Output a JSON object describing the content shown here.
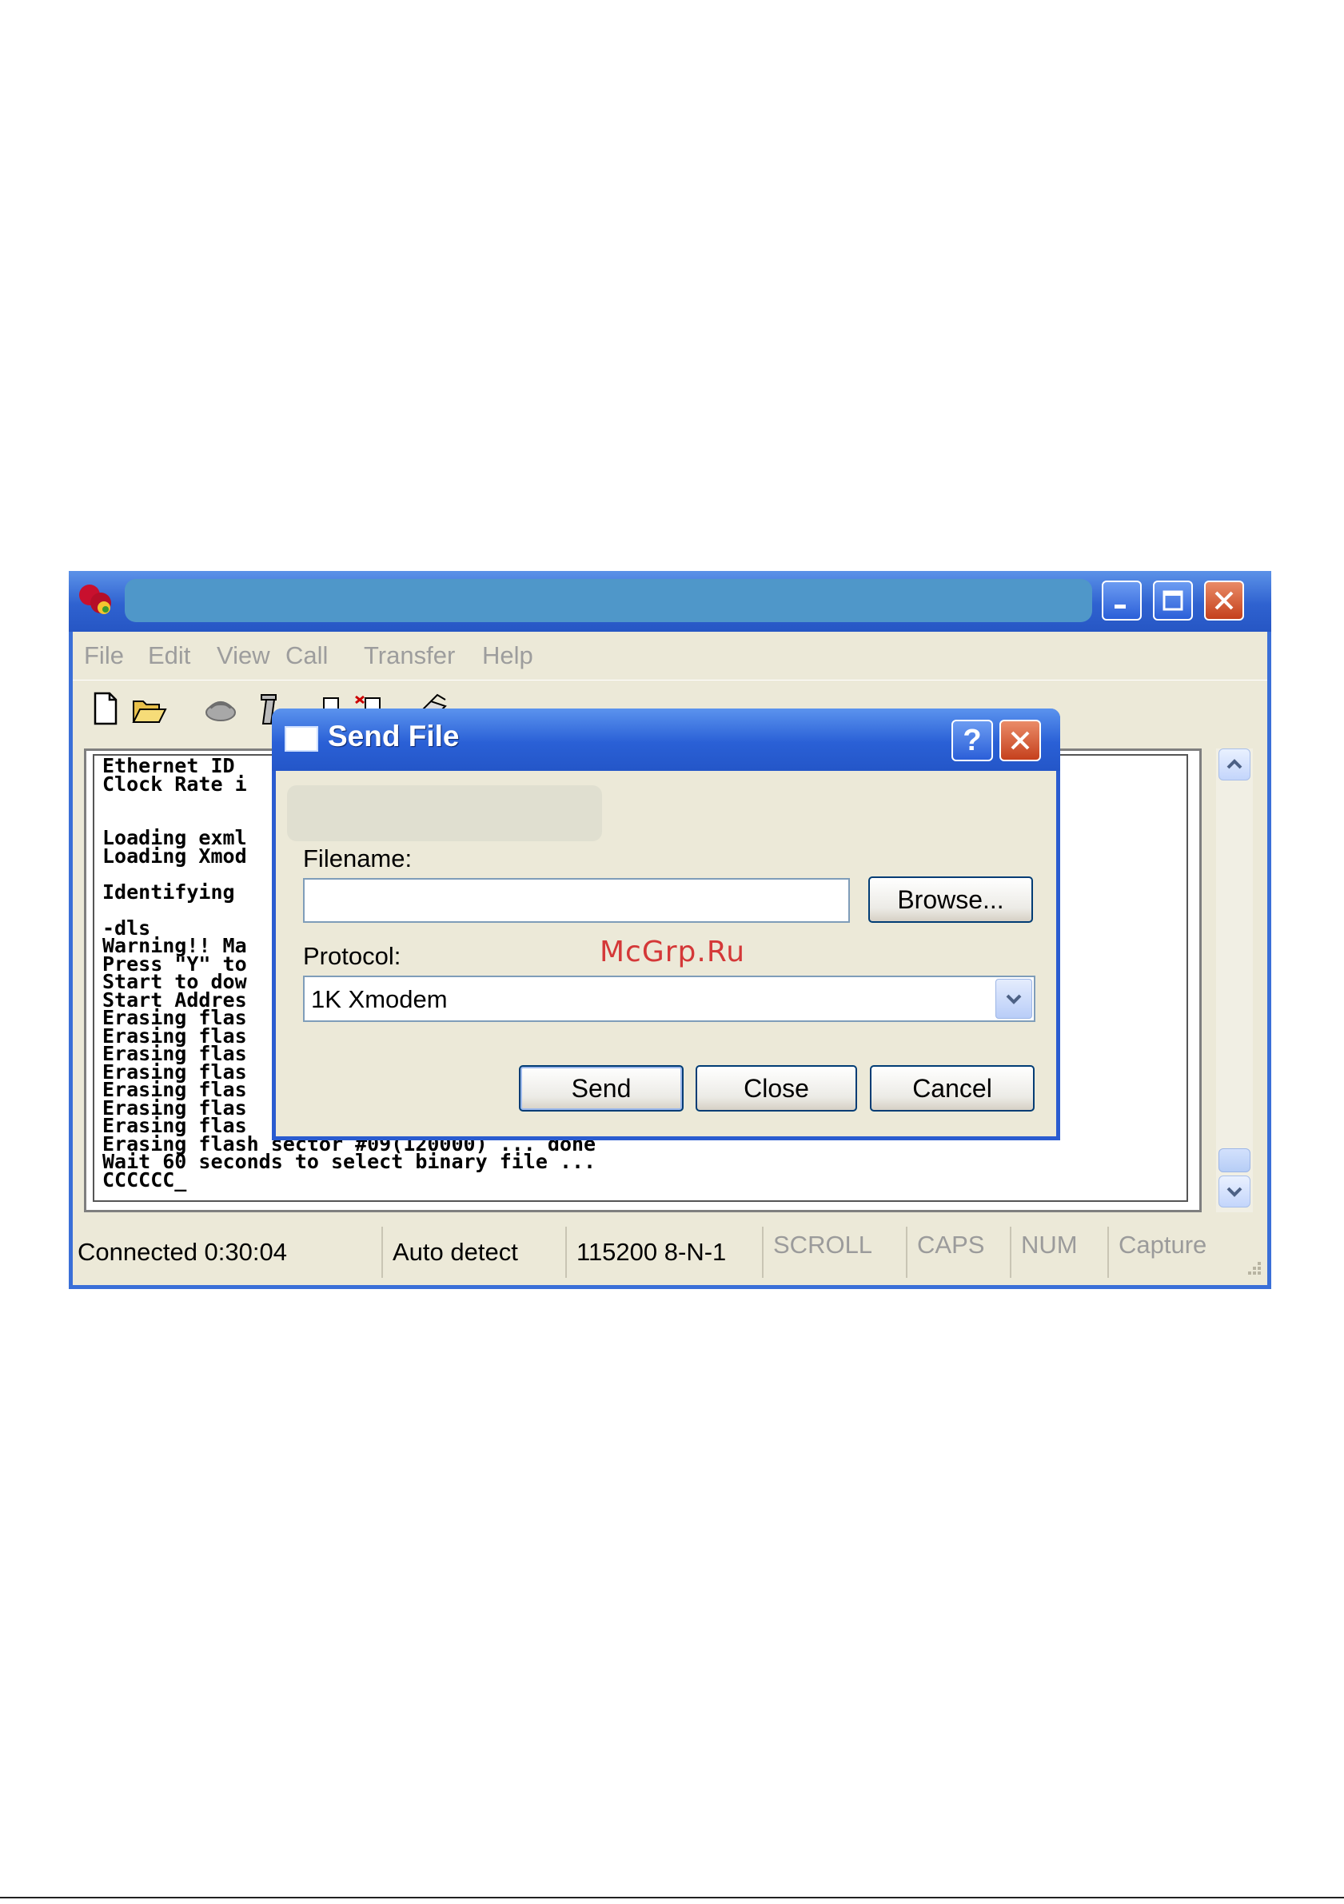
{
  "window": {
    "menu": [
      "File",
      "Edit",
      "View",
      "Call",
      "Transfer",
      "Help"
    ],
    "icons": [
      "new-document-icon",
      "open-folder-icon",
      "connect-icon",
      "disconnect-icon",
      "send-icon",
      "receive-icon",
      "properties-icon"
    ]
  },
  "terminal": {
    "lines": [
      "Ethernet ID",
      "Clock Rate i",
      "",
      "",
      "Loading exml",
      "Loading Xmod",
      "",
      "Identifying",
      "",
      "-dls",
      "Warning!! Ma",
      "Press \"Y\" to",
      "Start to dow",
      "Start Addres",
      "Erasing flas",
      "Erasing flas",
      "Erasing flas",
      "Erasing flas",
      "Erasing flas",
      "Erasing flas",
      "Erasing flas",
      "Erasing flash sector #09(120000) ... done",
      "Wait 60 seconds to select binary file ...",
      "CCCCCC_"
    ]
  },
  "status": {
    "connected": "Connected 0:30:04",
    "detect": "Auto detect",
    "port": "115200 8-N-1",
    "scroll": "SCROLL",
    "caps": "CAPS",
    "num": "NUM",
    "capture": "Capture"
  },
  "dialog": {
    "title": "Send File",
    "filename_label": "Filename:",
    "filename_value": "",
    "browse_label": "Browse...",
    "protocol_label": "Protocol:",
    "protocol_value": "1K Xmodem",
    "send_label": "Send",
    "close_label": "Close",
    "cancel_label": "Cancel"
  },
  "watermark": "McGrp.Ru",
  "colors": {
    "titlebar": "#2f62d0",
    "window_bg": "#ece9d8",
    "close_red": "#c4401c"
  }
}
